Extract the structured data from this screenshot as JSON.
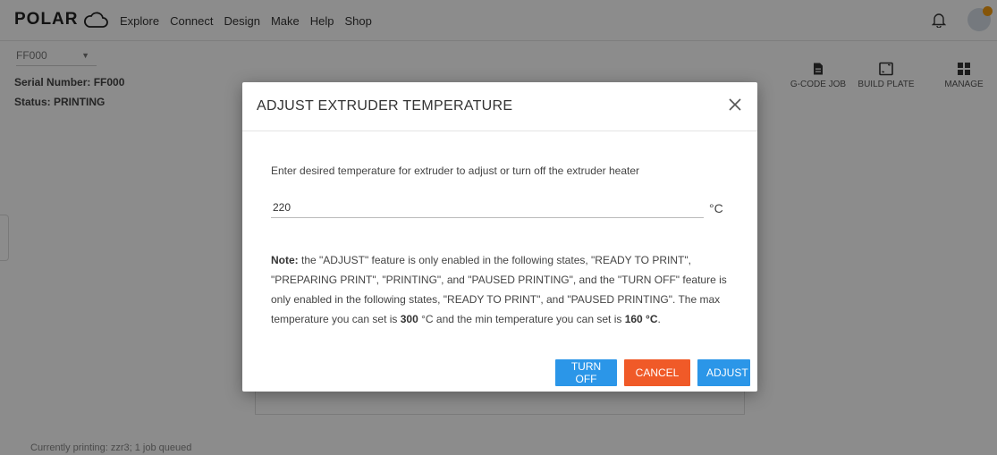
{
  "brand": {
    "name": "POLAR"
  },
  "nav": {
    "items": [
      "Explore",
      "Connect",
      "Design",
      "Make",
      "Help",
      "Shop"
    ]
  },
  "printer": {
    "select_value": "FF000",
    "serial_label": "Serial Number: FF000",
    "status_label": "Status: PRINTING"
  },
  "actions": {
    "gcode": "G-CODE JOB",
    "build_plate": "BUILD PLATE",
    "manage": "MANAGE"
  },
  "footer": {
    "currently_printing": "Currently printing: zzr3; 1 job queued"
  },
  "modal": {
    "title": "ADJUST EXTRUDER TEMPERATURE",
    "instruction": "Enter desired temperature for extruder to adjust or turn off the extruder heater",
    "temperature_value": "220",
    "unit": "°C",
    "note_label": "Note:",
    "note_part1": " the \"ADJUST\" feature is only enabled in the following states, \"READY TO PRINT\", \"PREPARING PRINT\", \"PRINTING\", and \"PAUSED PRINTING\", and the \"TURN OFF\" feature is only enabled in the following states, \"READY TO PRINT\", and \"PAUSED PRINTING\". The max temperature you can set is ",
    "note_max": "300",
    "note_part2": " °C and the min temperature you can set is ",
    "note_min": "160 °C",
    "note_end": ".",
    "buttons": {
      "turn_off": "TURN OFF",
      "cancel": "CANCEL",
      "adjust": "ADJUST"
    }
  },
  "colors": {
    "primary": "#2b96e8",
    "danger": "#f05a28",
    "badge": "#f39c12"
  }
}
